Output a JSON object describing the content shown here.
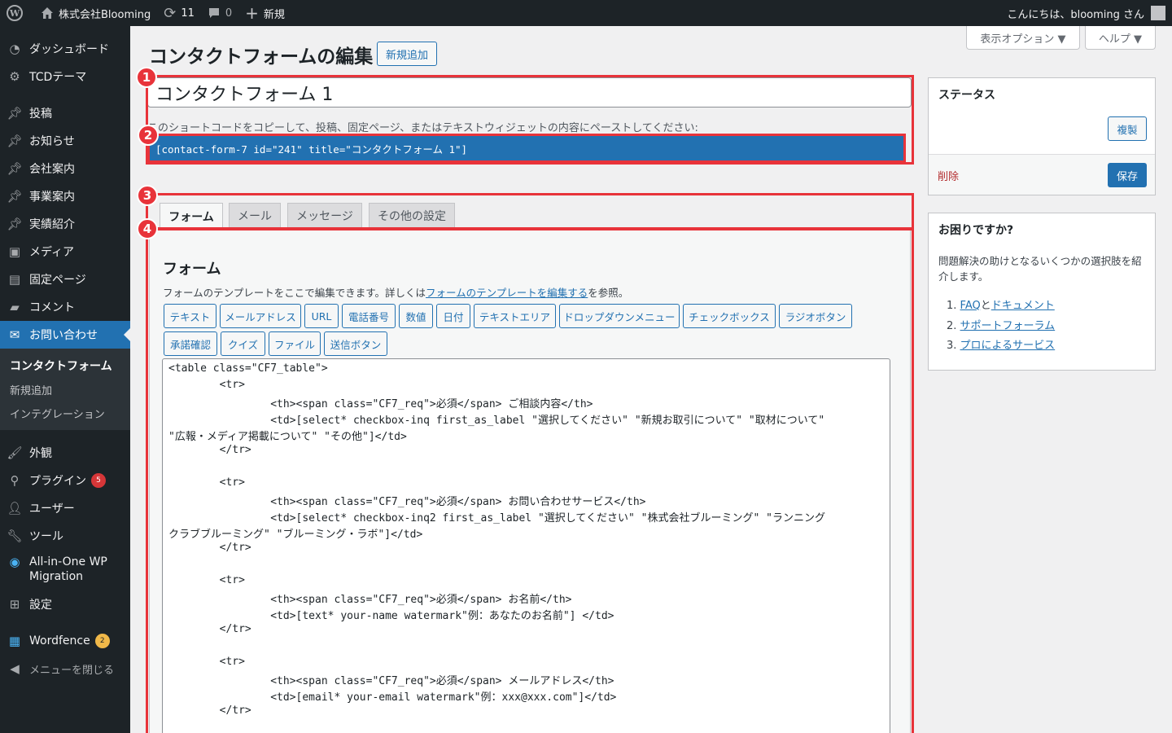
{
  "adminbar": {
    "site_name": "株式会社Blooming",
    "updates_count": "11",
    "comments_count": "0",
    "new_label": "新規",
    "greeting": "こんにちは、blooming さん"
  },
  "sidebar": {
    "items": [
      {
        "label": "ダッシュボード",
        "icon": "dashboard-icon"
      },
      {
        "label": "TCDテーマ",
        "icon": "gear-icon"
      },
      {
        "label": "投稿",
        "icon": "pin-icon"
      },
      {
        "label": "お知らせ",
        "icon": "pin-icon"
      },
      {
        "label": "会社案内",
        "icon": "pin-icon"
      },
      {
        "label": "事業案内",
        "icon": "pin-icon"
      },
      {
        "label": "実績紹介",
        "icon": "pin-icon"
      },
      {
        "label": "メディア",
        "icon": "media-icon"
      },
      {
        "label": "固定ページ",
        "icon": "page-icon"
      },
      {
        "label": "コメント",
        "icon": "comment-icon"
      },
      {
        "label": "お問い合わせ",
        "icon": "mail-icon"
      },
      {
        "label": "外観",
        "icon": "brush-icon"
      },
      {
        "label": "プラグイン",
        "icon": "plugin-icon",
        "badge": "5"
      },
      {
        "label": "ユーザー",
        "icon": "user-icon"
      },
      {
        "label": "ツール",
        "icon": "wrench-icon"
      },
      {
        "label": "All-in-One WP",
        "label2": "Migration",
        "icon": "migration-icon"
      },
      {
        "label": "設定",
        "icon": "settings-icon"
      },
      {
        "label": "Wordfence",
        "icon": "wordfence-icon",
        "badge": "2"
      },
      {
        "label": "メニューを閉じる",
        "icon": "collapse-icon"
      }
    ],
    "submenu": [
      "コンタクトフォーム",
      "新規追加",
      "インテグレーション"
    ]
  },
  "screen_meta": {
    "options_label": "表示オプション ▼",
    "help_label": "ヘルプ ▼"
  },
  "main": {
    "page_title": "コンタクトフォームの編集",
    "add_new_label": "新規追加",
    "form_title_value": "コンタクトフォーム 1",
    "shortcode_desc": "このショートコードをコピーして、投稿、固定ページ、またはテキストウィジェットの内容にペーストしてください:",
    "shortcode": "[contact-form-7 id=\"241\" title=\"コンタクトフォーム 1\"]",
    "tabs": [
      "フォーム",
      "メール",
      "メッセージ",
      "その他の設定"
    ],
    "panel_heading": "フォーム",
    "panel_desc_prefix": "フォームのテンプレートをここで編集できます。詳しくは",
    "panel_desc_link": "フォームのテンプレートを編集する",
    "panel_desc_suffix": "を参照。",
    "tag_buttons": [
      "テキスト",
      "メールアドレス",
      "URL",
      "電話番号",
      "数値",
      "日付",
      "テキストエリア",
      "ドロップダウンメニュー",
      "チェックボックス",
      "ラジオボタン",
      "承諾確認",
      "クイズ",
      "ファイル",
      "送信ボタン"
    ],
    "code_lines": [
      "<table class=\"CF7_table\">",
      "        <tr>",
      "                <th><span class=\"CF7_req\">必須</span> ご相談内容</th>",
      "                <td>[select* checkbox-inq first_as_label \"選択してください\" \"新規お取引について\" \"取材について\"",
      "\"広報・メディア掲載について\" \"その他\"]</td>",
      "        </tr>",
      "",
      "        <tr>",
      "                <th><span class=\"CF7_req\">必須</span> お問い合わせサービス</th>",
      "                <td>[select* checkbox-inq2 first_as_label \"選択してください\" \"株式会社ブルーミング\" \"ランニング",
      "クラブブルーミング\" \"ブルーミング・ラボ\"]</td>",
      "        </tr>",
      "",
      "        <tr>",
      "                <th><span class=\"CF7_req\">必須</span> お名前</th>",
      "                <td>[text* your-name watermark\"例：あなたのお名前\"] </td>",
      "        </tr>",
      "",
      "        <tr>",
      "                <th><span class=\"CF7_req\">必須</span> メールアドレス</th>",
      "                <td>[email* your-email watermark\"例：xxx@xxx.com\"]</td>",
      "        </tr>"
    ]
  },
  "status_box": {
    "title": "ステータス",
    "duplicate_label": "複製",
    "delete_label": "削除",
    "save_label": "保存"
  },
  "help_box": {
    "title": "お困りですか?",
    "desc": "問題解決の助けとなるいくつかの選択肢を紹介します。",
    "item1_num": "1.",
    "item1_a": "FAQ",
    "item1_mid": "と",
    "item1_b": "ドキュメント",
    "item2_num": "2.",
    "item2": "サポートフォーラム",
    "item3_num": "3.",
    "item3": "プロによるサービス"
  },
  "annotations": [
    "1",
    "2",
    "3",
    "4"
  ],
  "colors": {
    "accent": "#2271b1",
    "annotation": "#e8333a",
    "adminbar": "#1d2327"
  }
}
